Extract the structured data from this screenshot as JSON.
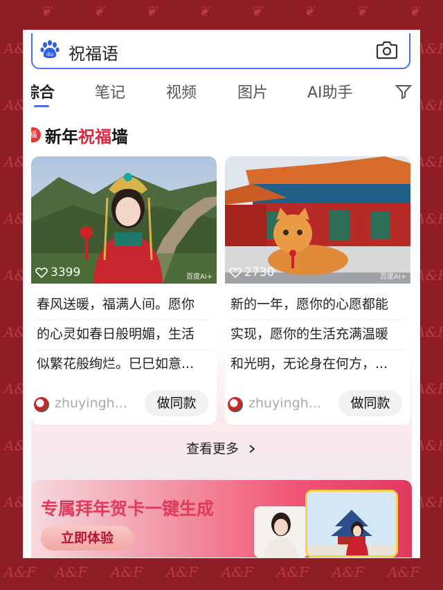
{
  "search": {
    "query": "祝福语",
    "logo_icon": "baidu-paw-icon",
    "camera_icon": "camera-icon"
  },
  "tabs": [
    {
      "label": "综合",
      "active": true
    },
    {
      "label": "笔记",
      "active": false
    },
    {
      "label": "视频",
      "active": false
    },
    {
      "label": "图片",
      "active": false
    },
    {
      "label": "AI助手",
      "active": false
    }
  ],
  "section": {
    "badge": "福",
    "title_prefix": "新年",
    "title_highlight": "祝福",
    "title_suffix": "墙"
  },
  "cards": [
    {
      "likes": "3399",
      "watermark": "百度Ai+",
      "lines": [
        "春风送暖，福满人间。愿你",
        "的心灵如春日般明媚，生活",
        "似繁花般绚烂。巳巳如意..."
      ],
      "user": "zhuyingh...",
      "button": "做同款"
    },
    {
      "likes": "2730",
      "watermark": "百度Ai+",
      "lines": [
        "新的一年，愿你的心愿都能",
        "实现，愿你的生活充满温暖",
        "和光明，无论身在何方，..."
      ],
      "user": "zhuyingh...",
      "button": "做同款"
    }
  ],
  "more": {
    "label": "查看更多",
    "icon": "chevron-right-icon"
  },
  "banner": {
    "title": "专属拜年贺卡一键生成",
    "button": "立即体验"
  },
  "colors": {
    "accent": "#4e6ef2",
    "highlight_red": "#e0243b",
    "background": "#8e1d25"
  }
}
